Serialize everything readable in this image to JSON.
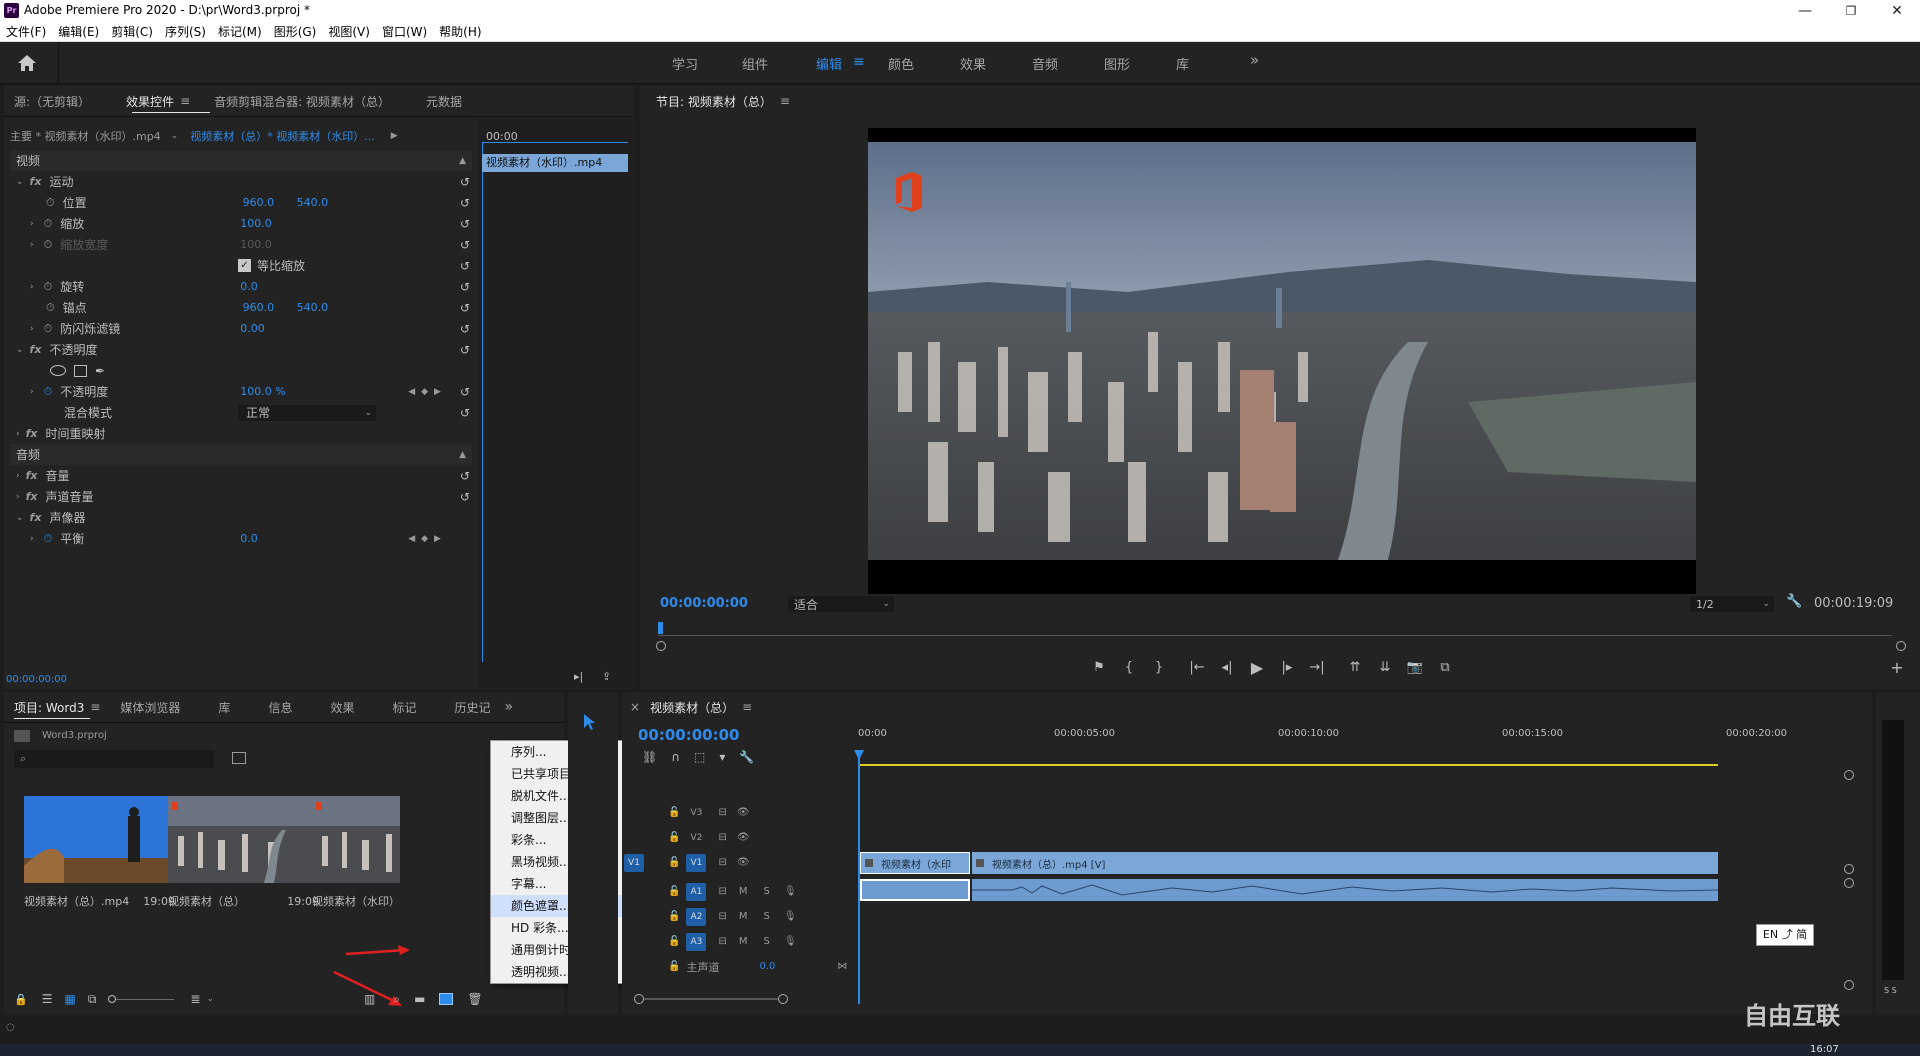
{
  "titlebar": {
    "logo": "Pr",
    "title": "Adobe Premiere Pro 2020 - D:\\pr\\Word3.prproj *",
    "minimize": "—",
    "maximize": "❐",
    "close": "✕"
  },
  "menubar": [
    "文件(F)",
    "编辑(E)",
    "剪辑(C)",
    "序列(S)",
    "标记(M)",
    "图形(G)",
    "视图(V)",
    "窗口(W)",
    "帮助(H)"
  ],
  "workspaces": {
    "items": [
      "学习",
      "组件",
      "编辑",
      "颜色",
      "效果",
      "音频",
      "图形",
      "库"
    ],
    "active": "编辑",
    "more": "»",
    "menu_icon": "≡"
  },
  "source_panel": {
    "tabs": [
      "源:（无剪辑）",
      "效果控件",
      "音频剪辑混合器: 视频素材（总）",
      "元数据"
    ],
    "active_tab": "效果控件",
    "tab_menu_icon": "≡",
    "clip_master": "主要 * 视频素材（水印）.mp4",
    "clip_seq": "视频素材（总）* 视频素材（水印）...",
    "mini_timecode": "00:00",
    "mini_clip": "视频素材（水印）.mp4",
    "section_video": "视频",
    "motion": {
      "label": "运动",
      "position": {
        "label": "位置",
        "x": "960.0",
        "y": "540.0"
      },
      "scale": {
        "label": "缩放",
        "value": "100.0"
      },
      "scale_width": {
        "label": "缩放宽度",
        "value": "100.0"
      },
      "uniform": {
        "label": "等比缩放",
        "checked": true
      },
      "rotation": {
        "label": "旋转",
        "value": "0.0"
      },
      "anchor": {
        "label": "锚点",
        "x": "960.0",
        "y": "540.0"
      },
      "antiflicker": {
        "label": "防闪烁滤镜",
        "value": "0.00"
      }
    },
    "opacity": {
      "label": "不透明度",
      "value_label": "不透明度",
      "value": "100.0 %",
      "blend_label": "混合模式",
      "blend": "正常"
    },
    "time_remap": "时间重映射",
    "section_audio": "音频",
    "volume": "音量",
    "channel_volume": "声道音量",
    "panner": {
      "label": "声像器",
      "balance_label": "平衡",
      "balance": "0.0"
    },
    "bottom_timecode": "00:00:00:00"
  },
  "program": {
    "title": "节目: 视频素材（总）",
    "menu_icon": "≡",
    "timecode": "00:00:00:00",
    "fit": "适合",
    "resolution": "1/2",
    "duration": "00:00:19:09"
  },
  "project": {
    "tabs": [
      "项目: Word3",
      "媒体浏览器",
      "库",
      "信息",
      "效果",
      "标记",
      "历史记"
    ],
    "more": "»",
    "tab_menu_icon": "≡",
    "file": "Word3.prproj",
    "search_placeholder": "",
    "items": [
      {
        "name": "视频素材（总）.mp4",
        "duration": "19:09"
      },
      {
        "name": "视频素材（总）",
        "duration": "19:09"
      },
      {
        "name": "视频素材（水印）",
        "duration": ""
      }
    ]
  },
  "context_menu": [
    "序列...",
    "已共享项目...",
    "脱机文件...",
    "调整图层...",
    "彩条...",
    "黑场视频...",
    "字幕...",
    "颜色遮罩...",
    "HD 彩条...",
    "通用倒计时片头...",
    "透明视频..."
  ],
  "context_menu_hover": "颜色遮罩...",
  "timeline": {
    "title": "视频素材（总）",
    "close_icon": "×",
    "menu_icon": "≡",
    "timecode": "00:00:00:00",
    "ruler": [
      "00:00",
      "00:00:05:00",
      "00:00:10:00",
      "00:00:15:00",
      "00:00:20:00"
    ],
    "tracks_video": [
      "V3",
      "V2",
      "V1"
    ],
    "tracks_audio": [
      "A1",
      "A2",
      "A3"
    ],
    "source_patch_v": "V1",
    "master_label": "主声道",
    "master_value": "0.0",
    "clip1": "视频素材（水印",
    "clip2": "视频素材（总）.mp4 [V]",
    "mute": "M",
    "solo": "S",
    "ime": "EN ⤴ 简"
  },
  "audio_meter": {
    "labels": "S S"
  },
  "taskbar": {
    "time": "16:07"
  },
  "watermark": "自由互联",
  "colors": {
    "accent": "#2d8ceb",
    "clip": "#7aa7d8",
    "panel": "#232323",
    "bg": "#1d1d1d"
  }
}
